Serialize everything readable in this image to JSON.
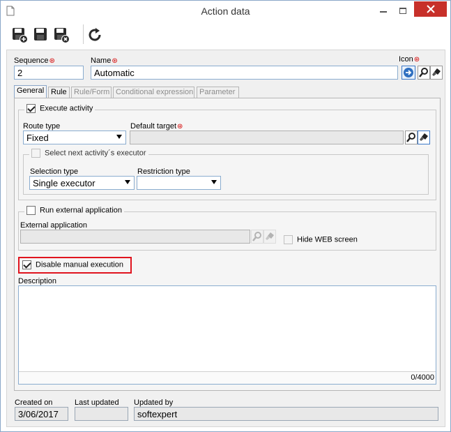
{
  "window": {
    "title": "Action data"
  },
  "form": {
    "sequence_label": "Sequence",
    "sequence_value": "2",
    "name_label": "Name",
    "name_value": "Automatic",
    "icon_label": "Icon",
    "required_mark": "⊛"
  },
  "tabs": [
    {
      "label": "General"
    },
    {
      "label": "Rule"
    },
    {
      "label": "Rule/Form"
    },
    {
      "label": "Conditional expression"
    },
    {
      "label": "Parameter"
    }
  ],
  "general": {
    "execute_activity_label": "Execute activity",
    "route_type_label": "Route type",
    "route_type_value": "Fixed",
    "default_target_label": "Default target",
    "default_target_value": "",
    "select_next_label": "Select next activity´s executor",
    "selection_type_label": "Selection type",
    "selection_type_value": "Single executor",
    "restriction_type_label": "Restriction type",
    "restriction_type_value": "",
    "run_external_label": "Run external application",
    "external_app_label": "External application",
    "external_app_value": "",
    "hide_web_label": "Hide WEB screen",
    "disable_manual_label": "Disable manual execution",
    "description_label": "Description",
    "description_value": "",
    "description_counter": "0/4000"
  },
  "footer": {
    "created_on_label": "Created on",
    "created_on_value": "3/06/2017",
    "last_updated_label": "Last updated",
    "last_updated_value": "",
    "updated_by_label": "Updated by",
    "updated_by_value": "softexpert"
  },
  "colors": {
    "accent": "#3b78c8",
    "highlight": "#e0141e",
    "close": "#c7302a",
    "required": "#d40000"
  }
}
